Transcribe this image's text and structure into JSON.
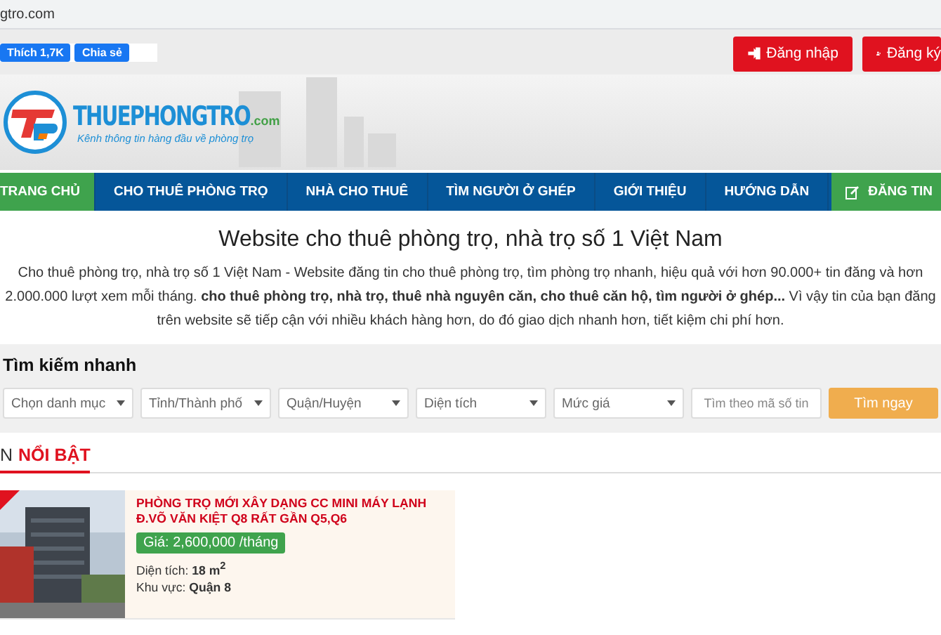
{
  "address_bar": {
    "url": "gtro.com"
  },
  "social": [
    {
      "label": "Thích",
      "count": "1,7K"
    },
    {
      "label": "Chia sẻ"
    }
  ],
  "auth_buttons": [
    {
      "label": "Đăng nhập",
      "kind": "login"
    },
    {
      "label": "Đăng ký",
      "kind": "register"
    }
  ],
  "logo": {
    "name": "THUEPHONGTRO",
    "suffix": ".com",
    "tagline": "Kênh thông tin hàng đầu về phòng trọ"
  },
  "nav": {
    "items": [
      {
        "label": "TRANG CHỦ",
        "selected": true
      },
      {
        "label": "CHO THUÊ PHÒNG TRỌ",
        "selected": false
      },
      {
        "label": "NHÀ CHO THUÊ",
        "selected": false
      },
      {
        "label": "TÌM NGƯỜI Ở GHÉP",
        "selected": false
      },
      {
        "label": "GIỚI THIỆU",
        "selected": false
      },
      {
        "label": "HƯỚNG DẪN",
        "selected": false
      }
    ],
    "post_button": "ĐĂNG TIN"
  },
  "intro": {
    "title": "Website cho thuê phòng trọ, nhà trọ số 1 Việt Nam",
    "text": "Cho thuê phòng trọ, nhà trọ số 1 Việt Nam - Website đăng tin cho thuê phòng trọ, tìm phòng trọ nhanh, hiệu quả với hơn 90.000+ tin đăng và hơn 2.000.000 lượt xem mỗi tháng. **cho thuê phòng trọ, nhà trọ, thuê nhà nguyên căn, cho thuê căn hộ, tìm người ở ghép...** Vì vậy tin của bạn đăng trên website sẽ tiếp cận với nhiều khách hàng hơn, do đó giao dịch nhanh hơn, tiết kiệm chi phí hơn."
  },
  "search": {
    "title": "Tìm kiếm nhanh",
    "selects": [
      "Chọn danh mục",
      "Tỉnh/Thành phố",
      "Quận/Huyện",
      "Diện tích",
      "Mức giá"
    ],
    "code_field": {
      "placeholder": "Tìm theo mã số tin"
    },
    "button": "Tìm ngay"
  },
  "section": {
    "prefix": "N",
    "title": "NỔI BẬT"
  },
  "listings": [
    {
      "title": "PHÒNG TRỌ MỚI XÂY DẠNG CC MINI MÁY LẠNH Đ.VÕ VĂN KIỆT Q8 RẤT GẦN Q5,Q6",
      "price": "Giá: 2,600,000 /tháng",
      "area": "Diện tích: **18 m$^{2}$**",
      "region": "Khu vực: **Quận 8**"
    }
  ]
}
